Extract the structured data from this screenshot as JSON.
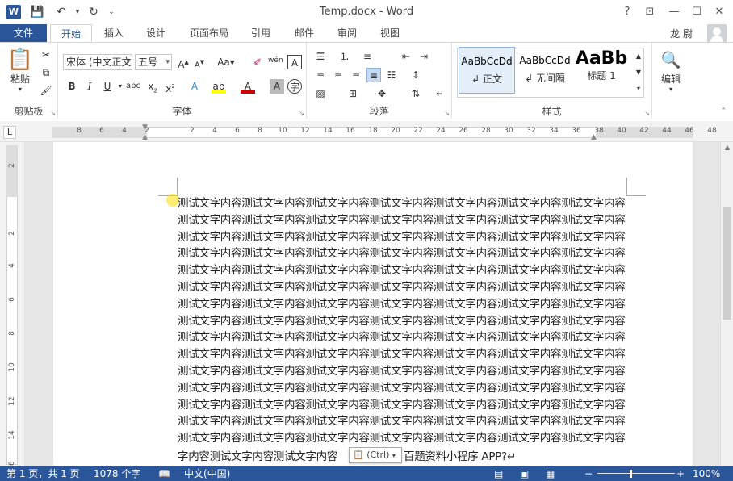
{
  "titlebar": {
    "app_icon": "W",
    "title": "Temp.docx - Word",
    "help": "?",
    "minimize": "—",
    "maximize": "☐",
    "close": "✕"
  },
  "tabs": {
    "file": "文件",
    "items": [
      "开始",
      "插入",
      "设计",
      "页面布局",
      "引用",
      "邮件",
      "审阅",
      "视图"
    ],
    "active": "开始",
    "user": "龙 尉"
  },
  "ribbon": {
    "clipboard": {
      "label": "剪贴板",
      "paste": "粘贴"
    },
    "font": {
      "label": "字体",
      "font_name": "宋体 (中文正文",
      "font_size": "五号"
    },
    "paragraph": {
      "label": "段落"
    },
    "styles": {
      "label": "样式",
      "items": [
        {
          "sample": "AaBbCcDd",
          "name": "↲ 正文"
        },
        {
          "sample": "AaBbCcDd",
          "name": "↲ 无间隔"
        },
        {
          "sample": "AaBb",
          "name": "标题 1"
        }
      ]
    },
    "editing": {
      "label": "编辑"
    }
  },
  "ruler": {
    "h_numbers": [
      "8",
      "6",
      "4",
      "2",
      "2",
      "4",
      "6",
      "8",
      "10",
      "12",
      "14",
      "16",
      "18",
      "20",
      "22",
      "24",
      "26",
      "28",
      "30",
      "32",
      "34",
      "36",
      "38",
      "40",
      "42",
      "44",
      "46",
      "48"
    ],
    "v_numbers": [
      "2",
      "2",
      "4",
      "6",
      "8",
      "10",
      "12",
      "14",
      "16"
    ]
  },
  "document": {
    "body": "测试文字内容测试文字内容测试文字内容测试文字内容测试文字内容测试文字内容测试文字内容测试文字内容测试文字内容测试文字内容测试文字内容测试文字内容测试文字内容测试文字内容测试文字内容测试文字内容测试文字内容测试文字内容测试文字内容测试文字内容测试文字内容测试文字内容测试文字内容测试文字内容测试文字内容测试文字内容测试文字内容测试文字内容测试文字内容测试文字内容测试文字内容测试文字内容测试文字内容测试文字内容测试文字内容测试文字内容测试文字内容测试文字内容测试文字内容测试文字内容测试文字内容测试文字内容测试文字内容测试文字内容测试文字内容测试文字内容测试文字内容测试文字内容测试文字内容测试文字内容测试文字内容测试文字内容测试文字内容测试文字内容测试文字内容测试文字内容测试文字内容测试文字内容测试文字内容测试文字内容测试文字内容测试文字内容测试文字内容测试文字内容测试文字内容测试文字内容测试文字内容测试文字内容测试文字内容测试文字内容测试文字内容测试文字内容测试文字内容测试文字内容测试文字内容测试文字内容测试文字内容测试文字内容测试文字内容测试文字内容测试文字内容测试文字内容测试文字内容测试文字内容测试文字内容测试文字内容测试文字内容测试文字内容测试文字内容测试文字内容测试文字内容测试文字内容测试文字内容测试文字内容测试文字内容测试文字内容测试文字内容测试文字内容测试文字内容测试文字内容测试文字内容测试文字内容测试文字内容测试文字内容测试文字内容测试文字内容测试文字内容测试文字内容",
    "last_line_start": "字内容测试文字内容测试文字内容",
    "last_line_end": "百题资料小程序 APP?↵",
    "paste_options": "(Ctrl)"
  },
  "statusbar": {
    "page": "第 1 页，共 1 页",
    "words": "1078 个字",
    "language": "中文(中国)",
    "zoom": "100%"
  }
}
